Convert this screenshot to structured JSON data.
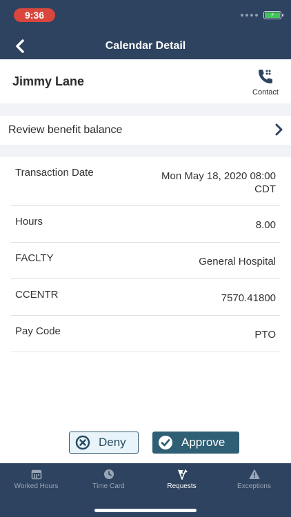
{
  "status_bar": {
    "time": "9:36"
  },
  "nav": {
    "title": "Calendar Detail"
  },
  "header": {
    "employee_name": "Jimmy Lane",
    "contact_label": "Contact"
  },
  "review": {
    "label": "Review benefit balance"
  },
  "details": [
    {
      "label": "Transaction Date",
      "value_line1": "Mon May 18, 2020 08:00",
      "value_line2": "CDT"
    },
    {
      "label": "Hours",
      "value_line1": "8.00"
    },
    {
      "label": "FACLTY",
      "value_line1": "General Hospital"
    },
    {
      "label": "CCENTR",
      "value_line1": "7570.41800"
    },
    {
      "label": "Pay Code",
      "value_line1": "PTO"
    }
  ],
  "actions": {
    "deny_label": "Deny",
    "approve_label": "Approve"
  },
  "tabs": [
    {
      "label": "Worked Hours",
      "icon": "calendar-icon",
      "active": false
    },
    {
      "label": "Time Card",
      "icon": "clock-icon",
      "active": false
    },
    {
      "label": "Requests",
      "icon": "flags-icon",
      "active": true
    },
    {
      "label": "Exceptions",
      "icon": "warning-icon",
      "active": false
    }
  ],
  "colors": {
    "nav_background": "#2e4360",
    "time_pill": "#d8463d",
    "battery": "#43c45a",
    "approve_button": "#2f5f74",
    "deny_button_bg": "#e8f4fa",
    "section_gap": "#f1f3f6"
  }
}
